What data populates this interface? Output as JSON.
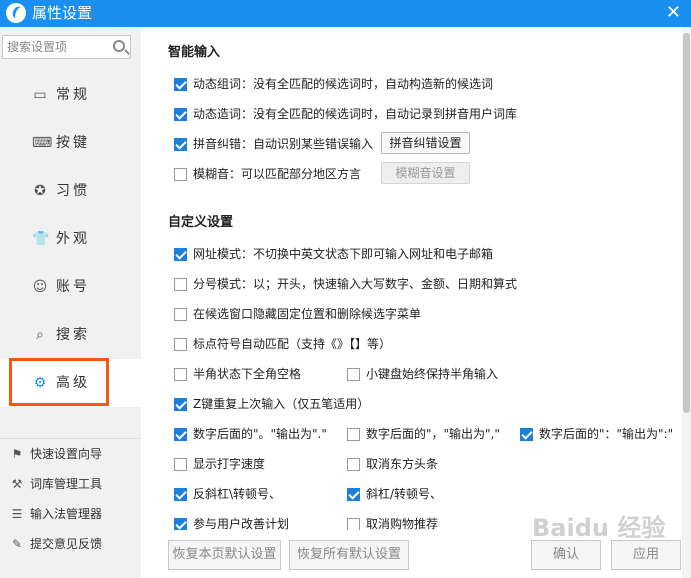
{
  "window": {
    "title": "属性设置",
    "close_label": "✕"
  },
  "sidebar": {
    "search_placeholder": "搜索设置项",
    "nav": [
      {
        "label": "常规",
        "icon": "monitor-icon"
      },
      {
        "label": "按键",
        "icon": "keyboard-icon"
      },
      {
        "label": "习惯",
        "icon": "star-icon"
      },
      {
        "label": "外观",
        "icon": "shirt-icon"
      },
      {
        "label": "账号",
        "icon": "user-icon"
      },
      {
        "label": "搜索",
        "icon": "search-icon"
      },
      {
        "label": "高级",
        "icon": "gear-icon",
        "active": true
      }
    ],
    "tools": [
      {
        "label": "快速设置向导",
        "icon": "flag-icon"
      },
      {
        "label": "词库管理工具",
        "icon": "tools-icon"
      },
      {
        "label": "输入法管理器",
        "icon": "list-icon"
      },
      {
        "label": "提交意见反馈",
        "icon": "feedback-icon"
      }
    ]
  },
  "main": {
    "smart_input": {
      "title": "智能输入",
      "options": [
        {
          "label": "动态组词：没有全匹配的候选词时，自动构造新的候选词",
          "checked": true
        },
        {
          "label": "动态造词：没有全匹配的候选词时，自动记录到拼音用户词库",
          "checked": true
        },
        {
          "label": "拼音纠错：自动识别某些错误输入",
          "checked": true,
          "button": "拼音纠错设置"
        },
        {
          "label": "模糊音：可以匹配部分地区方言",
          "checked": false,
          "button": "模糊音设置"
        }
      ]
    },
    "custom": {
      "title": "自定义设置",
      "options": [
        {
          "label": "网址模式：不切换中英文状态下即可输入网址和电子邮箱",
          "checked": true
        },
        {
          "label": "分号模式：以；开头，快速输入大写数字、金额、日期和算式",
          "checked": false
        },
        {
          "label": "在候选窗口隐藏固定位置和删除候选字菜单",
          "checked": false
        },
        {
          "label": "标点符号自动匹配（支持《》【】等）",
          "checked": false
        },
        {
          "label": "半角状态下全角空格",
          "checked": false
        },
        {
          "label": "小键盘始终保持半角输入",
          "checked": false
        },
        {
          "label": "Z键重复上次输入（仅五笔适用）",
          "checked": true
        },
        {
          "label": "数字后面的\"。\"输出为\".\"",
          "checked": true
        },
        {
          "label": "数字后面的\"，\"输出为\",\"",
          "checked": false
        },
        {
          "label": "数字后面的\"：\"输出为\":\"",
          "checked": true
        },
        {
          "label": "显示打字速度",
          "checked": false
        },
        {
          "label": "取消东方头条",
          "checked": false
        },
        {
          "label": "反斜杠\\转顿号、",
          "checked": true
        },
        {
          "label": "斜杠/转顿号、",
          "checked": true
        },
        {
          "label": "参与用户改善计划",
          "checked": true
        },
        {
          "label": "取消购物推荐",
          "checked": false
        }
      ]
    }
  },
  "footer": {
    "restore_page": "恢复本页默认设置",
    "restore_all": "恢复所有默认设置",
    "ok": "确认",
    "apply": "应用"
  },
  "watermark": "Baidu 经验"
}
